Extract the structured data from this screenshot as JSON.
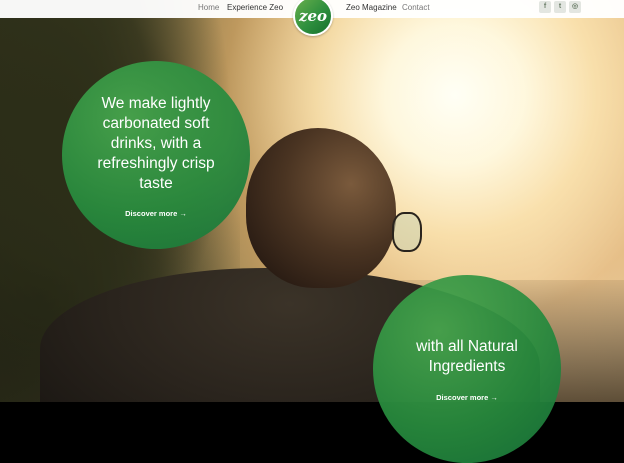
{
  "nav": {
    "home": "Home",
    "experience": "Experience Zeo",
    "magazine": "Zeo Magazine",
    "contact": "Contact",
    "logo_text": "zeo"
  },
  "social": [
    {
      "icon": "facebook-icon",
      "glyph": "f"
    },
    {
      "icon": "twitter-icon",
      "glyph": "t"
    },
    {
      "icon": "instagram-icon",
      "glyph": "◎"
    }
  ],
  "hero": {
    "primary": {
      "heading": "We make lightly carbonated soft drinks, with a refreshingly crisp taste",
      "link": "Discover more →"
    },
    "secondary": {
      "heading": "with all Natural Ingredients",
      "link": "Discover more →"
    }
  },
  "colors": {
    "bubble_green": "#2e8f3e",
    "nav_bg": "#ffffff",
    "nav_text": "#333333"
  }
}
